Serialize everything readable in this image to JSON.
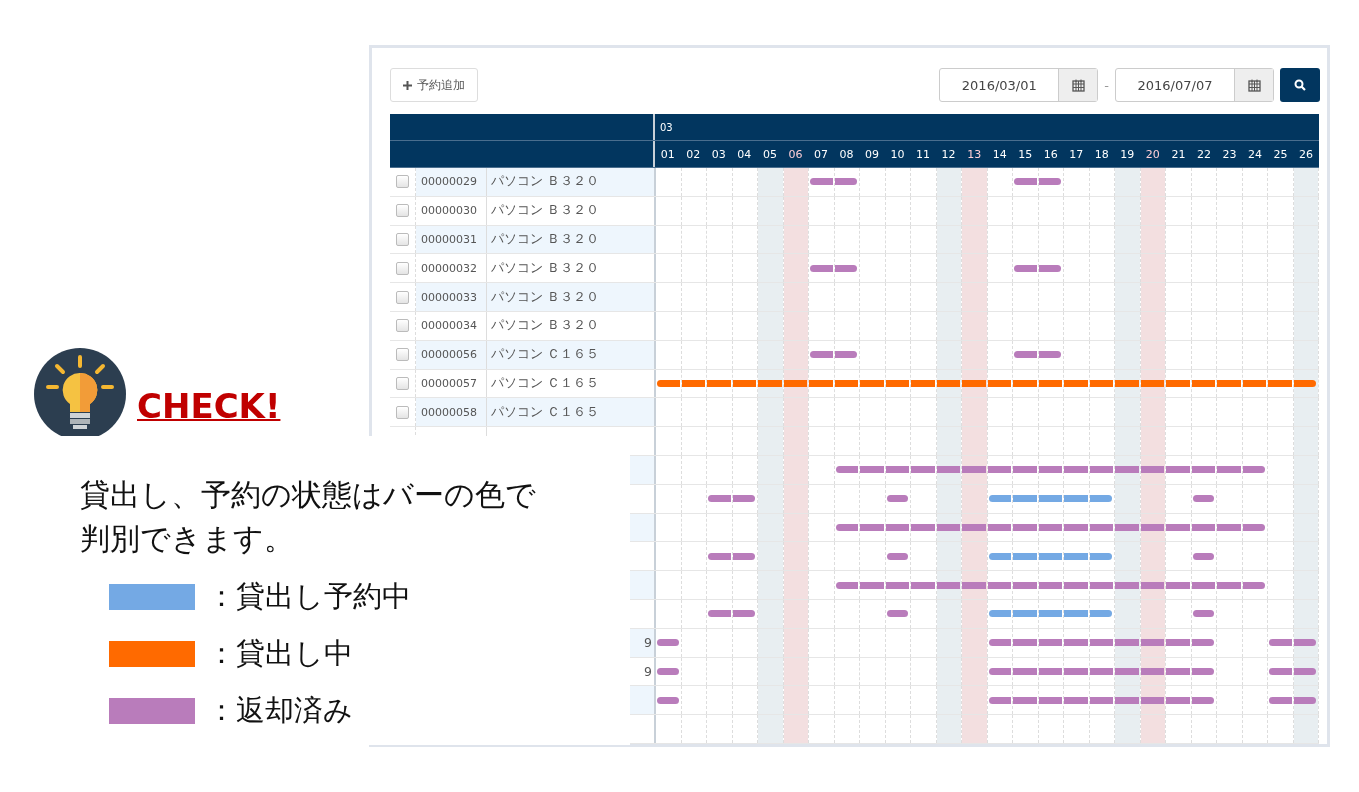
{
  "toolbar": {
    "add_button": "予約追加",
    "date_from": "2016/03/01",
    "separator": "-",
    "date_to": "2016/07/07"
  },
  "gantt": {
    "month": "03",
    "days": [
      {
        "label": "01",
        "kind": "weekday"
      },
      {
        "label": "02",
        "kind": "weekday"
      },
      {
        "label": "03",
        "kind": "weekday"
      },
      {
        "label": "04",
        "kind": "weekday"
      },
      {
        "label": "05",
        "kind": "saturday"
      },
      {
        "label": "06",
        "kind": "sunday"
      },
      {
        "label": "07",
        "kind": "weekday"
      },
      {
        "label": "08",
        "kind": "weekday"
      },
      {
        "label": "09",
        "kind": "weekday"
      },
      {
        "label": "10",
        "kind": "weekday"
      },
      {
        "label": "11",
        "kind": "weekday"
      },
      {
        "label": "12",
        "kind": "saturday"
      },
      {
        "label": "13",
        "kind": "sunday"
      },
      {
        "label": "14",
        "kind": "weekday"
      },
      {
        "label": "15",
        "kind": "weekday"
      },
      {
        "label": "16",
        "kind": "weekday"
      },
      {
        "label": "17",
        "kind": "weekday"
      },
      {
        "label": "18",
        "kind": "weekday"
      },
      {
        "label": "19",
        "kind": "saturday"
      },
      {
        "label": "20",
        "kind": "sunday"
      },
      {
        "label": "21",
        "kind": "weekday"
      },
      {
        "label": "22",
        "kind": "weekday"
      },
      {
        "label": "23",
        "kind": "weekday"
      },
      {
        "label": "24",
        "kind": "weekday"
      },
      {
        "label": "25",
        "kind": "weekday"
      },
      {
        "label": "26",
        "kind": "saturday"
      }
    ],
    "rows": [
      {
        "checked": false,
        "id": "00000029",
        "name": "パソコン Ｂ３２０",
        "slots": [
          {
            "kind": "none"
          },
          {
            "kind": "none"
          },
          {
            "kind": "none"
          },
          {
            "kind": "none"
          },
          {
            "kind": "none"
          },
          {
            "kind": "none"
          },
          {
            "kind": "returned"
          },
          {
            "kind": "returned"
          },
          {
            "kind": "none"
          },
          {
            "kind": "none"
          },
          {
            "kind": "none"
          },
          {
            "kind": "none"
          },
          {
            "kind": "none"
          },
          {
            "kind": "none"
          },
          {
            "kind": "returned"
          },
          {
            "kind": "returned"
          },
          {
            "kind": "none"
          },
          {
            "kind": "none"
          },
          {
            "kind": "none"
          },
          {
            "kind": "none"
          },
          {
            "kind": "none"
          },
          {
            "kind": "none"
          },
          {
            "kind": "none"
          },
          {
            "kind": "none"
          },
          {
            "kind": "none"
          },
          {
            "kind": "none"
          }
        ]
      },
      {
        "checked": false,
        "id": "00000030",
        "name": "パソコン Ｂ３２０"
      },
      {
        "checked": false,
        "id": "00000031",
        "name": "パソコン Ｂ３２０"
      },
      {
        "checked": false,
        "id": "00000032",
        "name": "パソコン Ｂ３２０",
        "slots": [
          {
            "kind": "none"
          },
          {
            "kind": "none"
          },
          {
            "kind": "none"
          },
          {
            "kind": "none"
          },
          {
            "kind": "none"
          },
          {
            "kind": "none"
          },
          {
            "kind": "returned"
          },
          {
            "kind": "returned"
          },
          {
            "kind": "none"
          },
          {
            "kind": "none"
          },
          {
            "kind": "none"
          },
          {
            "kind": "none"
          },
          {
            "kind": "none"
          },
          {
            "kind": "none"
          },
          {
            "kind": "returned"
          },
          {
            "kind": "returned"
          },
          {
            "kind": "none"
          },
          {
            "kind": "none"
          },
          {
            "kind": "none"
          },
          {
            "kind": "none"
          },
          {
            "kind": "none"
          },
          {
            "kind": "none"
          },
          {
            "kind": "none"
          },
          {
            "kind": "none"
          },
          {
            "kind": "none"
          },
          {
            "kind": "none"
          }
        ]
      },
      {
        "checked": false,
        "id": "00000033",
        "name": "パソコン Ｂ３２０"
      },
      {
        "checked": false,
        "id": "00000034",
        "name": "パソコン Ｂ３２０"
      },
      {
        "checked": false,
        "id": "00000056",
        "name": "パソコン Ｃ１６５",
        "slots": [
          {
            "kind": "none"
          },
          {
            "kind": "none"
          },
          {
            "kind": "none"
          },
          {
            "kind": "none"
          },
          {
            "kind": "none"
          },
          {
            "kind": "none"
          },
          {
            "kind": "returned"
          },
          {
            "kind": "returned"
          },
          {
            "kind": "none"
          },
          {
            "kind": "none"
          },
          {
            "kind": "none"
          },
          {
            "kind": "none"
          },
          {
            "kind": "none"
          },
          {
            "kind": "none"
          },
          {
            "kind": "returned"
          },
          {
            "kind": "returned"
          },
          {
            "kind": "none"
          },
          {
            "kind": "none"
          },
          {
            "kind": "none"
          },
          {
            "kind": "none"
          },
          {
            "kind": "none"
          },
          {
            "kind": "none"
          },
          {
            "kind": "none"
          },
          {
            "kind": "none"
          },
          {
            "kind": "none"
          },
          {
            "kind": "none"
          }
        ]
      },
      {
        "checked": false,
        "id": "00000057",
        "name": "パソコン Ｃ１６５",
        "slots": [
          {
            "kind": "lending"
          },
          {
            "kind": "lending"
          },
          {
            "kind": "lending"
          },
          {
            "kind": "lending"
          },
          {
            "kind": "lending"
          },
          {
            "kind": "lending"
          },
          {
            "kind": "lending"
          },
          {
            "kind": "lending"
          },
          {
            "kind": "lending"
          },
          {
            "kind": "lending"
          },
          {
            "kind": "lending"
          },
          {
            "kind": "lending"
          },
          {
            "kind": "lending"
          },
          {
            "kind": "lending"
          },
          {
            "kind": "lending"
          },
          {
            "kind": "lending"
          },
          {
            "kind": "lending"
          },
          {
            "kind": "lending"
          },
          {
            "kind": "lending"
          },
          {
            "kind": "lending"
          },
          {
            "kind": "lending"
          },
          {
            "kind": "lending"
          },
          {
            "kind": "lending"
          },
          {
            "kind": "lending"
          },
          {
            "kind": "lending"
          },
          {
            "kind": "lending"
          }
        ]
      },
      {
        "checked": false,
        "id": "00000058",
        "name": "パソコン Ｃ１６５"
      },
      {
        "slots": [
          {
            "kind": "none"
          },
          {
            "kind": "none"
          },
          {
            "kind": "none"
          },
          {
            "kind": "none"
          },
          {
            "kind": "none"
          },
          {
            "kind": "none"
          },
          {
            "kind": "none"
          },
          {
            "kind": "none"
          },
          {
            "kind": "none"
          },
          {
            "kind": "none"
          },
          {
            "kind": "none"
          },
          {
            "kind": "none"
          },
          {
            "kind": "none"
          },
          {
            "kind": "none"
          },
          {
            "kind": "none"
          },
          {
            "kind": "none"
          },
          {
            "kind": "none"
          },
          {
            "kind": "none"
          },
          {
            "kind": "none"
          },
          {
            "kind": "none"
          },
          {
            "kind": "none"
          },
          {
            "kind": "none"
          },
          {
            "kind": "none"
          },
          {
            "kind": "none"
          },
          {
            "kind": "none"
          },
          {
            "kind": "none"
          }
        ]
      },
      {
        "slots": [
          {
            "kind": "none"
          },
          {
            "kind": "none"
          },
          {
            "kind": "none"
          },
          {
            "kind": "none"
          },
          {
            "kind": "none"
          },
          {
            "kind": "none"
          },
          {
            "kind": "none"
          },
          {
            "kind": "returned"
          },
          {
            "kind": "returned"
          },
          {
            "kind": "returned"
          },
          {
            "kind": "returned"
          },
          {
            "kind": "returned"
          },
          {
            "kind": "returned"
          },
          {
            "kind": "returned"
          },
          {
            "kind": "returned"
          },
          {
            "kind": "returned"
          },
          {
            "kind": "returned"
          },
          {
            "kind": "returned"
          },
          {
            "kind": "returned"
          },
          {
            "kind": "returned"
          },
          {
            "kind": "returned"
          },
          {
            "kind": "returned"
          },
          {
            "kind": "returned"
          },
          {
            "kind": "returned"
          },
          {
            "kind": "none"
          },
          {
            "kind": "none"
          }
        ]
      },
      {
        "slots": [
          {
            "kind": "none"
          },
          {
            "kind": "none"
          },
          {
            "kind": "returned"
          },
          {
            "kind": "returned"
          },
          {
            "kind": "none"
          },
          {
            "kind": "none"
          },
          {
            "kind": "none"
          },
          {
            "kind": "none"
          },
          {
            "kind": "none"
          },
          {
            "kind": "returned"
          },
          {
            "kind": "none"
          },
          {
            "kind": "none"
          },
          {
            "kind": "none"
          },
          {
            "kind": "reserved"
          },
          {
            "kind": "reserved"
          },
          {
            "kind": "reserved"
          },
          {
            "kind": "reserved"
          },
          {
            "kind": "reserved"
          },
          {
            "kind": "none"
          },
          {
            "kind": "none"
          },
          {
            "kind": "none"
          },
          {
            "kind": "returned"
          },
          {
            "kind": "none"
          },
          {
            "kind": "none"
          },
          {
            "kind": "none"
          },
          {
            "kind": "none"
          }
        ]
      },
      {
        "slots": [
          {
            "kind": "none"
          },
          {
            "kind": "none"
          },
          {
            "kind": "none"
          },
          {
            "kind": "none"
          },
          {
            "kind": "none"
          },
          {
            "kind": "none"
          },
          {
            "kind": "none"
          },
          {
            "kind": "returned"
          },
          {
            "kind": "returned"
          },
          {
            "kind": "returned"
          },
          {
            "kind": "returned"
          },
          {
            "kind": "returned"
          },
          {
            "kind": "returned"
          },
          {
            "kind": "returned"
          },
          {
            "kind": "returned"
          },
          {
            "kind": "returned"
          },
          {
            "kind": "returned"
          },
          {
            "kind": "returned"
          },
          {
            "kind": "returned"
          },
          {
            "kind": "returned"
          },
          {
            "kind": "returned"
          },
          {
            "kind": "returned"
          },
          {
            "kind": "returned"
          },
          {
            "kind": "returned"
          },
          {
            "kind": "none"
          },
          {
            "kind": "none"
          }
        ]
      },
      {
        "slots": [
          {
            "kind": "none"
          },
          {
            "kind": "none"
          },
          {
            "kind": "returned"
          },
          {
            "kind": "returned"
          },
          {
            "kind": "none"
          },
          {
            "kind": "none"
          },
          {
            "kind": "none"
          },
          {
            "kind": "none"
          },
          {
            "kind": "none"
          },
          {
            "kind": "returned"
          },
          {
            "kind": "none"
          },
          {
            "kind": "none"
          },
          {
            "kind": "none"
          },
          {
            "kind": "reserved"
          },
          {
            "kind": "reserved"
          },
          {
            "kind": "reserved"
          },
          {
            "kind": "reserved"
          },
          {
            "kind": "reserved"
          },
          {
            "kind": "none"
          },
          {
            "kind": "none"
          },
          {
            "kind": "none"
          },
          {
            "kind": "returned"
          },
          {
            "kind": "none"
          },
          {
            "kind": "none"
          },
          {
            "kind": "none"
          },
          {
            "kind": "none"
          }
        ]
      },
      {
        "slots": [
          {
            "kind": "none"
          },
          {
            "kind": "none"
          },
          {
            "kind": "none"
          },
          {
            "kind": "none"
          },
          {
            "kind": "none"
          },
          {
            "kind": "none"
          },
          {
            "kind": "none"
          },
          {
            "kind": "returned"
          },
          {
            "kind": "returned"
          },
          {
            "kind": "returned"
          },
          {
            "kind": "returned"
          },
          {
            "kind": "returned"
          },
          {
            "kind": "returned"
          },
          {
            "kind": "returned"
          },
          {
            "kind": "returned"
          },
          {
            "kind": "returned"
          },
          {
            "kind": "returned"
          },
          {
            "kind": "returned"
          },
          {
            "kind": "returned"
          },
          {
            "kind": "returned"
          },
          {
            "kind": "returned"
          },
          {
            "kind": "returned"
          },
          {
            "kind": "returned"
          },
          {
            "kind": "returned"
          },
          {
            "kind": "none"
          },
          {
            "kind": "none"
          }
        ]
      },
      {
        "slots": [
          {
            "kind": "none"
          },
          {
            "kind": "none"
          },
          {
            "kind": "returned"
          },
          {
            "kind": "returned"
          },
          {
            "kind": "none"
          },
          {
            "kind": "none"
          },
          {
            "kind": "none"
          },
          {
            "kind": "none"
          },
          {
            "kind": "none"
          },
          {
            "kind": "returned"
          },
          {
            "kind": "none"
          },
          {
            "kind": "none"
          },
          {
            "kind": "none"
          },
          {
            "kind": "reserved"
          },
          {
            "kind": "reserved"
          },
          {
            "kind": "reserved"
          },
          {
            "kind": "reserved"
          },
          {
            "kind": "reserved"
          },
          {
            "kind": "none"
          },
          {
            "kind": "none"
          },
          {
            "kind": "none"
          },
          {
            "kind": "returned"
          },
          {
            "kind": "none"
          },
          {
            "kind": "none"
          },
          {
            "kind": "none"
          },
          {
            "kind": "none"
          }
        ]
      },
      {
        "name_tail": "9",
        "slots": [
          {
            "kind": "returned"
          },
          {
            "kind": "none"
          },
          {
            "kind": "none"
          },
          {
            "kind": "none"
          },
          {
            "kind": "none"
          },
          {
            "kind": "none"
          },
          {
            "kind": "none"
          },
          {
            "kind": "none"
          },
          {
            "kind": "none"
          },
          {
            "kind": "none"
          },
          {
            "kind": "none"
          },
          {
            "kind": "none"
          },
          {
            "kind": "none"
          },
          {
            "kind": "returned"
          },
          {
            "kind": "returned"
          },
          {
            "kind": "returned"
          },
          {
            "kind": "returned"
          },
          {
            "kind": "returned"
          },
          {
            "kind": "returned"
          },
          {
            "kind": "returned"
          },
          {
            "kind": "returned"
          },
          {
            "kind": "returned"
          },
          {
            "kind": "none"
          },
          {
            "kind": "none"
          },
          {
            "kind": "returned"
          },
          {
            "kind": "returned"
          }
        ]
      },
      {
        "name_tail": "9",
        "slots": [
          {
            "kind": "returned"
          },
          {
            "kind": "none"
          },
          {
            "kind": "none"
          },
          {
            "kind": "none"
          },
          {
            "kind": "none"
          },
          {
            "kind": "none"
          },
          {
            "kind": "none"
          },
          {
            "kind": "none"
          },
          {
            "kind": "none"
          },
          {
            "kind": "none"
          },
          {
            "kind": "none"
          },
          {
            "kind": "none"
          },
          {
            "kind": "none"
          },
          {
            "kind": "returned"
          },
          {
            "kind": "returned"
          },
          {
            "kind": "returned"
          },
          {
            "kind": "returned"
          },
          {
            "kind": "returned"
          },
          {
            "kind": "returned"
          },
          {
            "kind": "returned"
          },
          {
            "kind": "returned"
          },
          {
            "kind": "returned"
          },
          {
            "kind": "none"
          },
          {
            "kind": "none"
          },
          {
            "kind": "returned"
          },
          {
            "kind": "returned"
          }
        ]
      },
      {
        "slots": [
          {
            "kind": "returned"
          },
          {
            "kind": "none"
          },
          {
            "kind": "none"
          },
          {
            "kind": "none"
          },
          {
            "kind": "none"
          },
          {
            "kind": "none"
          },
          {
            "kind": "none"
          },
          {
            "kind": "none"
          },
          {
            "kind": "none"
          },
          {
            "kind": "none"
          },
          {
            "kind": "none"
          },
          {
            "kind": "none"
          },
          {
            "kind": "none"
          },
          {
            "kind": "returned"
          },
          {
            "kind": "returned"
          },
          {
            "kind": "returned"
          },
          {
            "kind": "returned"
          },
          {
            "kind": "returned"
          },
          {
            "kind": "returned"
          },
          {
            "kind": "returned"
          },
          {
            "kind": "returned"
          },
          {
            "kind": "returned"
          },
          {
            "kind": "none"
          },
          {
            "kind": "none"
          },
          {
            "kind": "returned"
          },
          {
            "kind": "returned"
          }
        ]
      },
      {
        "slots": [
          {
            "kind": "none"
          },
          {
            "kind": "none"
          },
          {
            "kind": "none"
          },
          {
            "kind": "none"
          },
          {
            "kind": "none"
          },
          {
            "kind": "none"
          },
          {
            "kind": "none"
          },
          {
            "kind": "none"
          },
          {
            "kind": "none"
          },
          {
            "kind": "none"
          },
          {
            "kind": "none"
          },
          {
            "kind": "none"
          },
          {
            "kind": "none"
          },
          {
            "kind": "none"
          },
          {
            "kind": "none"
          },
          {
            "kind": "none"
          },
          {
            "kind": "none"
          },
          {
            "kind": "none"
          },
          {
            "kind": "none"
          },
          {
            "kind": "none"
          },
          {
            "kind": "none"
          },
          {
            "kind": "none"
          },
          {
            "kind": "none"
          },
          {
            "kind": "none"
          },
          {
            "kind": "none"
          },
          {
            "kind": "none"
          }
        ]
      }
    ]
  },
  "callout": {
    "title": "CHECK!",
    "text": "貸出し、予約の状態はバーの色で判別できます。",
    "legend": [
      {
        "kind": "reserved",
        "color": "#74a9e4",
        "label": "：貸出し予約中"
      },
      {
        "kind": "lending",
        "color": "#ff6a00",
        "label": "：貸出し中"
      },
      {
        "kind": "returned",
        "color": "#b97cbb",
        "label": "：返却済み"
      }
    ]
  }
}
